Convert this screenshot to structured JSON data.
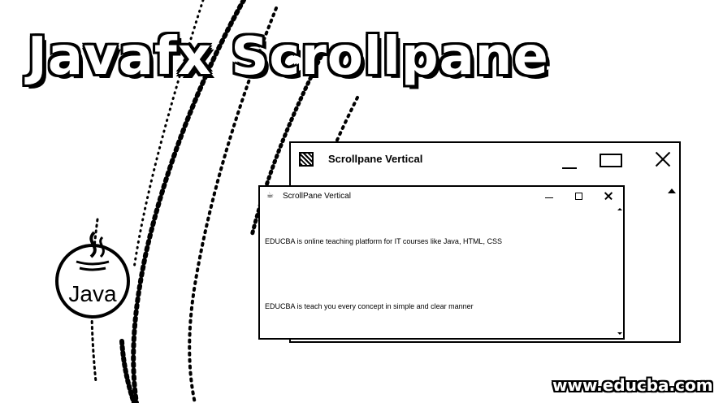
{
  "banner": {
    "title": "Javafx Scrollpane",
    "logo_text": "Java",
    "watermark": "www.educba.com"
  },
  "back_window": {
    "title": "Scrollpane Vertical",
    "icon": "app-grid-icon"
  },
  "front_window": {
    "title": "ScrollPane Vertical",
    "icon": "java-cup-icon",
    "lines": [
      "EDUCBA is online teaching platform for IT courses like Java, HTML, CSS",
      "EDUCBA is teach you every concept in simple and clear manner"
    ]
  },
  "colors": {
    "ink": "#000000",
    "paper": "#ffffff"
  }
}
